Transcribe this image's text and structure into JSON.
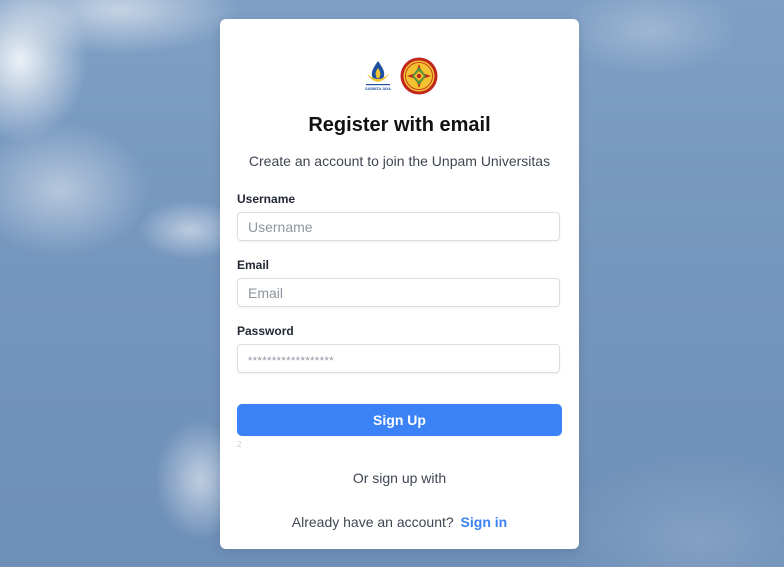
{
  "form": {
    "title": "Register with email",
    "subtitle": "Create an account to join the Unpam Universitas",
    "username_label": "Username",
    "username_placeholder": "Username",
    "email_label": "Email",
    "email_placeholder": "Email",
    "password_label": "Password",
    "password_placeholder": "******************",
    "signup_label": "Sign Up",
    "tiny_mark": "2",
    "or_text": "Or sign up with",
    "already_text": "Already have an account?",
    "signin_label": "Sign in"
  },
  "logos": {
    "left_icon": "sasmita-jaya-logo",
    "left_caption": "SASMITA JAYA",
    "right_icon": "unpam-seal-logo"
  },
  "colors": {
    "primary": "#3b82f6",
    "card_bg": "#ffffff",
    "text": "#3f4653",
    "background": "#7495bd"
  }
}
